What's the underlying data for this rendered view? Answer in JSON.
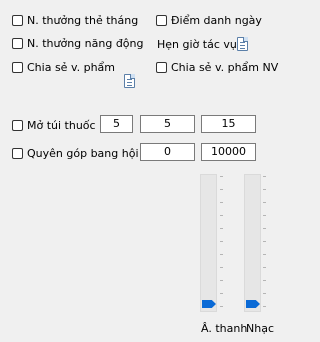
{
  "options": {
    "monthly_card_reward": "N. thưởng thẻ tháng",
    "daily_checkin": "Điểm danh ngày",
    "activity_reward": "N. thưởng năng động",
    "task_schedule": "Hẹn giờ tác vụ",
    "share_item": "Chia sẻ v. phẩm",
    "share_item_nv": "Chia sẻ v. phẩm NV"
  },
  "bag": {
    "label": "Mở túi thuốc",
    "values": [
      "5",
      "5",
      "15"
    ]
  },
  "donate": {
    "label": "Quyên góp bang hội",
    "values": [
      "0",
      "10000"
    ]
  },
  "sliders": {
    "sound_label": "Â. thanh",
    "music_label": "Nhạc",
    "sound_level": 0,
    "music_level": 0
  },
  "icons": [
    "checkbox-icon",
    "document-icon",
    "slider-thumb-icon"
  ]
}
